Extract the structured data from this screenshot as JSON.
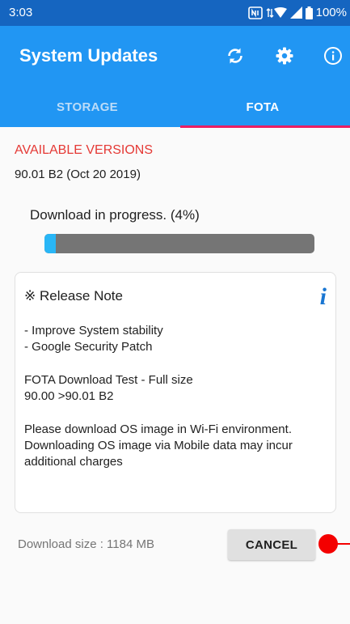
{
  "status_bar": {
    "time": "3:03",
    "battery": "100%",
    "icons": [
      "nfc-icon",
      "wifi-data-icon",
      "signal-icon",
      "battery-icon"
    ]
  },
  "app_bar": {
    "title": "System Updates",
    "actions": [
      "refresh-icon",
      "settings-icon",
      "info-icon"
    ]
  },
  "tabs": [
    {
      "label": "STORAGE",
      "selected": false
    },
    {
      "label": "FOTA",
      "selected": true
    }
  ],
  "fota": {
    "available_title": "AVAILABLE VERSIONS",
    "version": "90.01 B2 (Oct 20 2019)",
    "progress_label": "Download in progress. (4%)",
    "progress_fraction": 0.04,
    "release_note": {
      "heading": "※ Release Note",
      "info_glyph": "i",
      "paragraphs": [
        [
          "- Improve System stability",
          "- Google Security Patch"
        ],
        [
          "FOTA Download Test - Full size",
          "90.00 >90.01 B2"
        ],
        [
          "Please download OS image in Wi-Fi environment.",
          "Downloading OS image via  Mobile data may incur",
          "additional charges"
        ]
      ]
    },
    "download_size": "Download size : 1184 MB",
    "cancel_label": "CANCEL"
  },
  "colors": {
    "status_bar": "#1565c0",
    "app_bar": "#2196f3",
    "tab_indicator": "#e91e63",
    "title_red": "#e53935",
    "progress_fill": "#29b6f6",
    "progress_track": "#757575",
    "tap_marker": "#f40000"
  }
}
